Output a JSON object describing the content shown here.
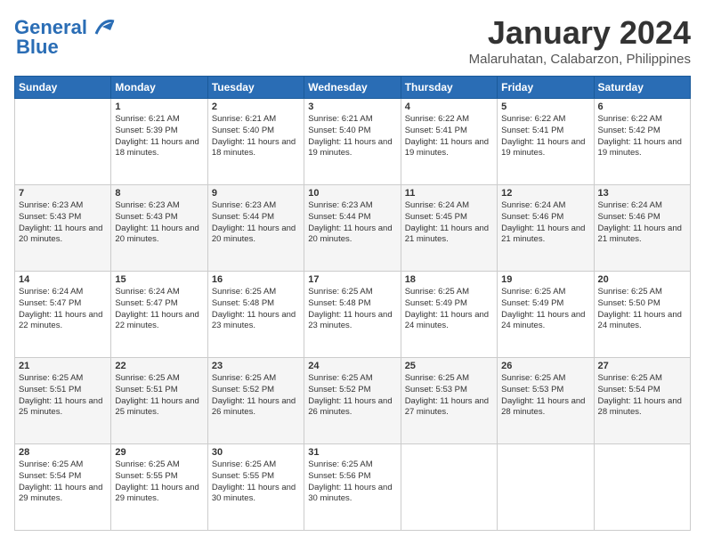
{
  "logo": {
    "line1": "General",
    "line2": "Blue"
  },
  "title": "January 2024",
  "location": "Malaruhatan, Calabarzon, Philippines",
  "days_header": [
    "Sunday",
    "Monday",
    "Tuesday",
    "Wednesday",
    "Thursday",
    "Friday",
    "Saturday"
  ],
  "weeks": [
    [
      {
        "day": "",
        "sunrise": "",
        "sunset": "",
        "daylight": ""
      },
      {
        "day": "1",
        "sunrise": "Sunrise: 6:21 AM",
        "sunset": "Sunset: 5:39 PM",
        "daylight": "Daylight: 11 hours and 18 minutes."
      },
      {
        "day": "2",
        "sunrise": "Sunrise: 6:21 AM",
        "sunset": "Sunset: 5:40 PM",
        "daylight": "Daylight: 11 hours and 18 minutes."
      },
      {
        "day": "3",
        "sunrise": "Sunrise: 6:21 AM",
        "sunset": "Sunset: 5:40 PM",
        "daylight": "Daylight: 11 hours and 19 minutes."
      },
      {
        "day": "4",
        "sunrise": "Sunrise: 6:22 AM",
        "sunset": "Sunset: 5:41 PM",
        "daylight": "Daylight: 11 hours and 19 minutes."
      },
      {
        "day": "5",
        "sunrise": "Sunrise: 6:22 AM",
        "sunset": "Sunset: 5:41 PM",
        "daylight": "Daylight: 11 hours and 19 minutes."
      },
      {
        "day": "6",
        "sunrise": "Sunrise: 6:22 AM",
        "sunset": "Sunset: 5:42 PM",
        "daylight": "Daylight: 11 hours and 19 minutes."
      }
    ],
    [
      {
        "day": "7",
        "sunrise": "Sunrise: 6:23 AM",
        "sunset": "Sunset: 5:43 PM",
        "daylight": "Daylight: 11 hours and 20 minutes."
      },
      {
        "day": "8",
        "sunrise": "Sunrise: 6:23 AM",
        "sunset": "Sunset: 5:43 PM",
        "daylight": "Daylight: 11 hours and 20 minutes."
      },
      {
        "day": "9",
        "sunrise": "Sunrise: 6:23 AM",
        "sunset": "Sunset: 5:44 PM",
        "daylight": "Daylight: 11 hours and 20 minutes."
      },
      {
        "day": "10",
        "sunrise": "Sunrise: 6:23 AM",
        "sunset": "Sunset: 5:44 PM",
        "daylight": "Daylight: 11 hours and 20 minutes."
      },
      {
        "day": "11",
        "sunrise": "Sunrise: 6:24 AM",
        "sunset": "Sunset: 5:45 PM",
        "daylight": "Daylight: 11 hours and 21 minutes."
      },
      {
        "day": "12",
        "sunrise": "Sunrise: 6:24 AM",
        "sunset": "Sunset: 5:46 PM",
        "daylight": "Daylight: 11 hours and 21 minutes."
      },
      {
        "day": "13",
        "sunrise": "Sunrise: 6:24 AM",
        "sunset": "Sunset: 5:46 PM",
        "daylight": "Daylight: 11 hours and 21 minutes."
      }
    ],
    [
      {
        "day": "14",
        "sunrise": "Sunrise: 6:24 AM",
        "sunset": "Sunset: 5:47 PM",
        "daylight": "Daylight: 11 hours and 22 minutes."
      },
      {
        "day": "15",
        "sunrise": "Sunrise: 6:24 AM",
        "sunset": "Sunset: 5:47 PM",
        "daylight": "Daylight: 11 hours and 22 minutes."
      },
      {
        "day": "16",
        "sunrise": "Sunrise: 6:25 AM",
        "sunset": "Sunset: 5:48 PM",
        "daylight": "Daylight: 11 hours and 23 minutes."
      },
      {
        "day": "17",
        "sunrise": "Sunrise: 6:25 AM",
        "sunset": "Sunset: 5:48 PM",
        "daylight": "Daylight: 11 hours and 23 minutes."
      },
      {
        "day": "18",
        "sunrise": "Sunrise: 6:25 AM",
        "sunset": "Sunset: 5:49 PM",
        "daylight": "Daylight: 11 hours and 24 minutes."
      },
      {
        "day": "19",
        "sunrise": "Sunrise: 6:25 AM",
        "sunset": "Sunset: 5:49 PM",
        "daylight": "Daylight: 11 hours and 24 minutes."
      },
      {
        "day": "20",
        "sunrise": "Sunrise: 6:25 AM",
        "sunset": "Sunset: 5:50 PM",
        "daylight": "Daylight: 11 hours and 24 minutes."
      }
    ],
    [
      {
        "day": "21",
        "sunrise": "Sunrise: 6:25 AM",
        "sunset": "Sunset: 5:51 PM",
        "daylight": "Daylight: 11 hours and 25 minutes."
      },
      {
        "day": "22",
        "sunrise": "Sunrise: 6:25 AM",
        "sunset": "Sunset: 5:51 PM",
        "daylight": "Daylight: 11 hours and 25 minutes."
      },
      {
        "day": "23",
        "sunrise": "Sunrise: 6:25 AM",
        "sunset": "Sunset: 5:52 PM",
        "daylight": "Daylight: 11 hours and 26 minutes."
      },
      {
        "day": "24",
        "sunrise": "Sunrise: 6:25 AM",
        "sunset": "Sunset: 5:52 PM",
        "daylight": "Daylight: 11 hours and 26 minutes."
      },
      {
        "day": "25",
        "sunrise": "Sunrise: 6:25 AM",
        "sunset": "Sunset: 5:53 PM",
        "daylight": "Daylight: 11 hours and 27 minutes."
      },
      {
        "day": "26",
        "sunrise": "Sunrise: 6:25 AM",
        "sunset": "Sunset: 5:53 PM",
        "daylight": "Daylight: 11 hours and 28 minutes."
      },
      {
        "day": "27",
        "sunrise": "Sunrise: 6:25 AM",
        "sunset": "Sunset: 5:54 PM",
        "daylight": "Daylight: 11 hours and 28 minutes."
      }
    ],
    [
      {
        "day": "28",
        "sunrise": "Sunrise: 6:25 AM",
        "sunset": "Sunset: 5:54 PM",
        "daylight": "Daylight: 11 hours and 29 minutes."
      },
      {
        "day": "29",
        "sunrise": "Sunrise: 6:25 AM",
        "sunset": "Sunset: 5:55 PM",
        "daylight": "Daylight: 11 hours and 29 minutes."
      },
      {
        "day": "30",
        "sunrise": "Sunrise: 6:25 AM",
        "sunset": "Sunset: 5:55 PM",
        "daylight": "Daylight: 11 hours and 30 minutes."
      },
      {
        "day": "31",
        "sunrise": "Sunrise: 6:25 AM",
        "sunset": "Sunset: 5:56 PM",
        "daylight": "Daylight: 11 hours and 30 minutes."
      },
      {
        "day": "",
        "sunrise": "",
        "sunset": "",
        "daylight": ""
      },
      {
        "day": "",
        "sunrise": "",
        "sunset": "",
        "daylight": ""
      },
      {
        "day": "",
        "sunrise": "",
        "sunset": "",
        "daylight": ""
      }
    ]
  ]
}
